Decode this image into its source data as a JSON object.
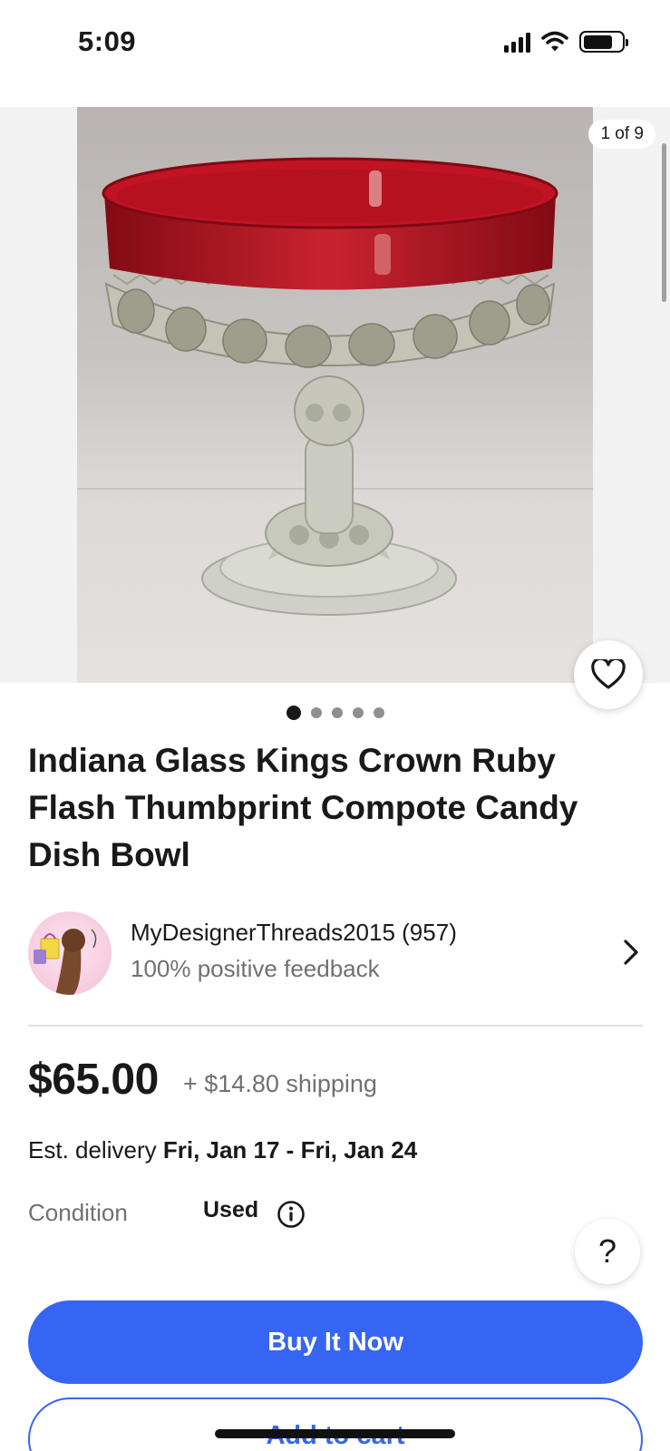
{
  "status_bar": {
    "time": "5:09"
  },
  "gallery": {
    "counter": "1 of 9",
    "image_alt": "Ruby flash thumbprint compote candy dish on pedestal",
    "dots_total": 5,
    "dots_active_index": 0,
    "watch_icon": "heart-outline-icon"
  },
  "item": {
    "title": "Indiana Glass Kings Crown Ruby Flash Thumbprint Compote Candy Dish Bowl"
  },
  "seller": {
    "name": "MyDesignerThreads2015 (957)",
    "feedback": "100% positive feedback",
    "chevron_icon": "chevron-right-icon"
  },
  "pricing": {
    "price": "$65.00",
    "shipping": "+ $14.80 shipping"
  },
  "delivery": {
    "label": "Est. delivery",
    "dates": "Fri, Jan 17 - Fri, Jan 24"
  },
  "condition": {
    "label": "Condition",
    "value": "Used",
    "info_icon": "info-icon"
  },
  "help": {
    "label": "?"
  },
  "actions": {
    "buy_now": "Buy It Now",
    "add_to_cart": "Add to cart"
  },
  "colors": {
    "primary_blue": "#3665f3",
    "text_primary": "#191919",
    "text_secondary": "#707070",
    "ruby": "#b3101c"
  }
}
